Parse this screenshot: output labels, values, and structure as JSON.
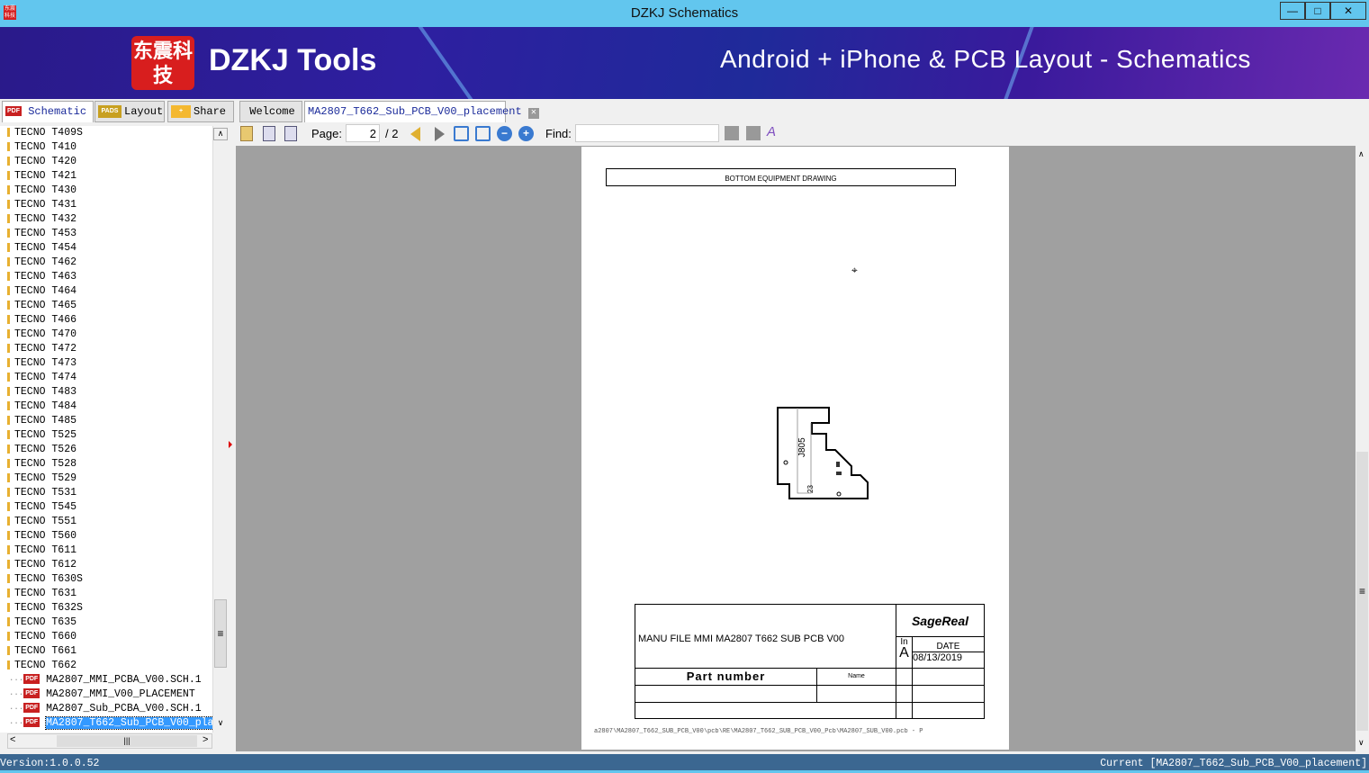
{
  "window": {
    "title": "DZKJ Schematics",
    "minimize": "—",
    "maximize": "□",
    "close": "✕"
  },
  "banner": {
    "logo_text": "东震科技",
    "brand": "DZKJ Tools",
    "slogan": "Android + iPhone & PCB Layout - Schematics"
  },
  "side_tabs": [
    {
      "label": "Schematic",
      "icon": "pdf-icon"
    },
    {
      "label": "Layout",
      "icon": "pads-icon"
    },
    {
      "label": "Share",
      "icon": "cloud-folder-icon"
    }
  ],
  "doc_tabs": [
    {
      "label": "Welcome"
    },
    {
      "label": "MA2807_T662_Sub_PCB_V00_placement",
      "active": true
    }
  ],
  "tree": {
    "folders": [
      "TECNO T409S",
      "TECNO T410",
      "TECNO T420",
      "TECNO T421",
      "TECNO T430",
      "TECNO T431",
      "TECNO T432",
      "TECNO T453",
      "TECNO T454",
      "TECNO T462",
      "TECNO T463",
      "TECNO T464",
      "TECNO T465",
      "TECNO T466",
      "TECNO T470",
      "TECNO T472",
      "TECNO T473",
      "TECNO T474",
      "TECNO T483",
      "TECNO T484",
      "TECNO T485",
      "TECNO T525",
      "TECNO T526",
      "TECNO T528",
      "TECNO T529",
      "TECNO T531",
      "TECNO T545",
      "TECNO T551",
      "TECNO T560",
      "TECNO T611",
      "TECNO T612",
      "TECNO T630S",
      "TECNO T631",
      "TECNO T632S",
      "TECNO T635",
      "TECNO T660",
      "TECNO T661",
      "TECNO T662"
    ],
    "files": [
      "MA2807_MMI_PCBA_V00.SCH.1",
      "MA2807_MMI_V00_PLACEMENT",
      "MA2807_Sub_PCBA_V00.SCH.1",
      "MA2807_T662_Sub_PCB_V00_placement"
    ],
    "selected_file": "MA2807_T662_Sub_PCB_V00_placement"
  },
  "toolbar": {
    "page_label": "Page:",
    "page_current": "2",
    "page_total": "/ 2",
    "find_label": "Find:",
    "find_value": ""
  },
  "document": {
    "header": "BOTTOM EQUIPMENT DRAWING",
    "component_label": "J805",
    "pin_label": "23",
    "title_block": {
      "title": "MANU FILE MMI   MA2807 T662 SUB PCB   V00",
      "logo": "SageReal",
      "in_label": "In",
      "date_label": "DATE",
      "rev": "A",
      "date": "08/13/2019",
      "part_number_label": "Part number",
      "name_label": "Name"
    },
    "path": "a2807\\MA2807_T662_SUB_PCB_V00\\pcb\\RE\\MA2807_T662_SUB_PCB_V00_Pcb\\MA2807_SUB_V00.pcb - P"
  },
  "status": {
    "version": "Version:1.0.0.52",
    "current": "Current [MA2807_T662_Sub_PCB_V00_placement]"
  }
}
